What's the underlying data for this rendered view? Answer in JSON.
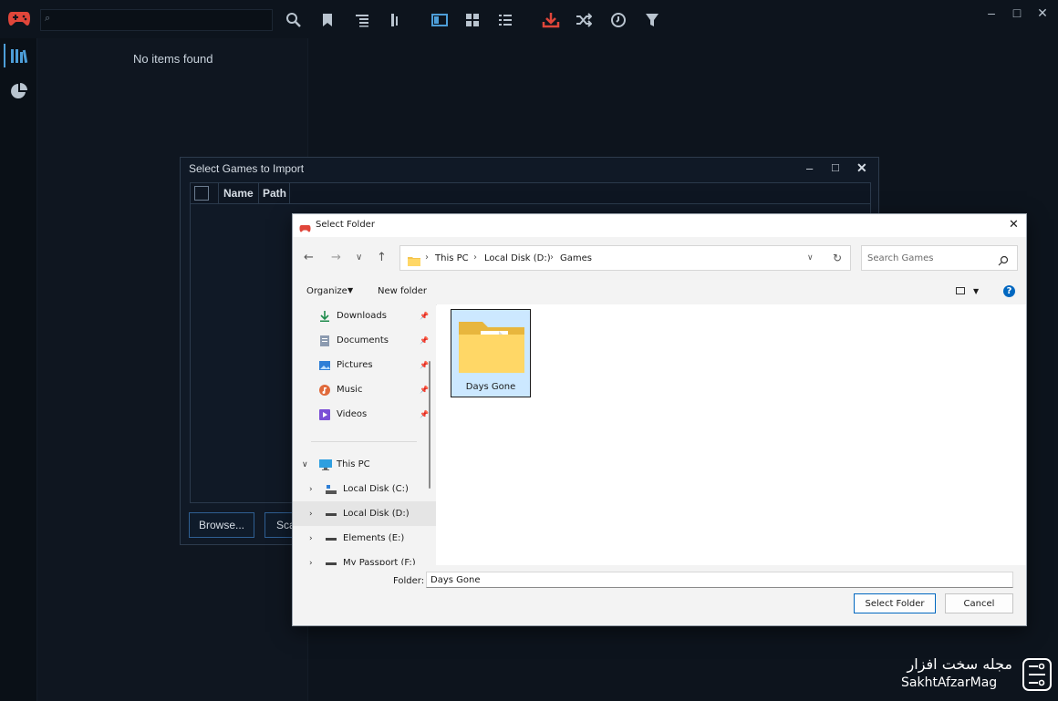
{
  "main": {
    "no_items": "No items found"
  },
  "import_dialog": {
    "title": "Select Games to Import",
    "columns": [
      "Name",
      "Path"
    ],
    "browse_label": "Browse...",
    "scan_label": "Sca"
  },
  "folder_dialog": {
    "title": "Select Folder",
    "path": [
      "This PC",
      "Local Disk (D:)",
      "Games"
    ],
    "search_placeholder": "Search Games",
    "organize_label": "Organize",
    "new_folder_label": "New folder",
    "quick_access": [
      {
        "label": "Downloads",
        "icon": "download-arrow-icon"
      },
      {
        "label": "Documents",
        "icon": "documents-icon"
      },
      {
        "label": "Pictures",
        "icon": "pictures-icon"
      },
      {
        "label": "Music",
        "icon": "music-icon"
      },
      {
        "label": "Videos",
        "icon": "videos-icon"
      }
    ],
    "this_pc_label": "This PC",
    "drives": [
      {
        "label": "Local Disk (C:)"
      },
      {
        "label": "Local Disk (D:)",
        "selected": true
      },
      {
        "label": "Elements (E:)"
      },
      {
        "label": "My Passport (F:)"
      }
    ],
    "items": [
      {
        "label": "Days Gone"
      }
    ],
    "folder_label": "Folder:",
    "folder_value": "Days Gone",
    "select_label": "Select Folder",
    "cancel_label": "Cancel"
  },
  "watermark": {
    "persian": "مجله سخت افزار",
    "latin": "SakhtAfzarMag"
  },
  "colors": {
    "accent_red": "#e0463a",
    "selection_blue": "#cce8ff",
    "primary_blue": "#0067c0"
  }
}
